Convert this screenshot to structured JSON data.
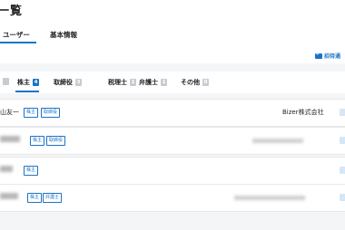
{
  "page": {
    "title": "一覧"
  },
  "tabs": [
    {
      "label": "ユーザー",
      "active": true
    },
    {
      "label": "基本情報",
      "active": false
    }
  ],
  "invite": {
    "label": "招待通"
  },
  "filters": [
    {
      "label": "株主",
      "count": "4",
      "active": true
    },
    {
      "label": "取締役",
      "count": "3",
      "active": false
    },
    {
      "label": "税理士",
      "count": "1",
      "active": false
    },
    {
      "label": "弁護士",
      "count": "1",
      "active": false
    },
    {
      "label": "その他",
      "count": "0",
      "active": false
    }
  ],
  "users": [
    {
      "name": "山友一",
      "tags": [
        "株主",
        "取締役"
      ],
      "company": "Bizer株式会社"
    },
    {
      "name": "",
      "tags": [
        "株主",
        "取締役"
      ],
      "company": ""
    },
    {
      "name": "",
      "tags": [
        "株主"
      ],
      "company": ""
    },
    {
      "name": "",
      "tags": [
        "株主",
        "弁護士"
      ],
      "company": ""
    }
  ],
  "colors": {
    "accent": "#1a73c6",
    "background": "#f4f5f7"
  }
}
